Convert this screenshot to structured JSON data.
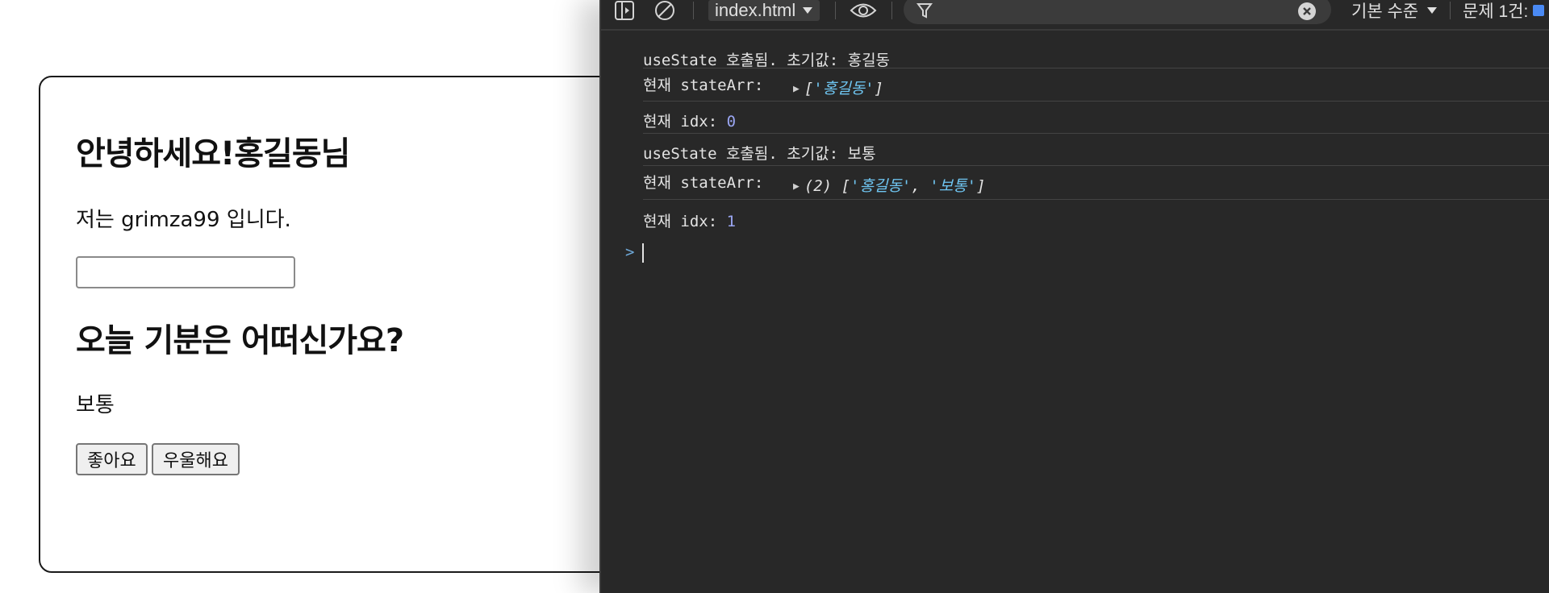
{
  "page": {
    "greeting": "안녕하세요!홍길동님",
    "intro": "저는 grimza99 입니다.",
    "name_input_value": "",
    "mood_question": "오늘 기분은 어떠신가요?",
    "mood_value": "보통",
    "buttons": {
      "good": "좋아요",
      "sad": "우울해요"
    }
  },
  "devtools": {
    "toolbar": {
      "context": "index.html",
      "filter_placeholder": "",
      "level": "기본 수준",
      "issues": "문제 1건:"
    },
    "console": [
      {
        "text": "useState 호출됨. 초기값: 홍길동"
      },
      {
        "text": "현재 stateArr:",
        "obj_prefix": "[",
        "obj_items": [
          "'홍길동'"
        ],
        "obj_suffix": "]"
      },
      {
        "text": "현재 idx: ",
        "value": "0"
      },
      {
        "text": "useState 호출됨. 초기값: 보통"
      },
      {
        "text": "현재 stateArr:",
        "obj_prefix": "(2) [",
        "obj_items": [
          "'홍길동'",
          "'보통'"
        ],
        "obj_suffix": "]"
      },
      {
        "text": "현재 idx: ",
        "value": "1"
      }
    ],
    "prompt": ">"
  },
  "colors": {
    "console_bg": "#282828",
    "string": "#6fc6f2",
    "number": "#9aa6f2",
    "issues_badge": "#4a8af4"
  }
}
